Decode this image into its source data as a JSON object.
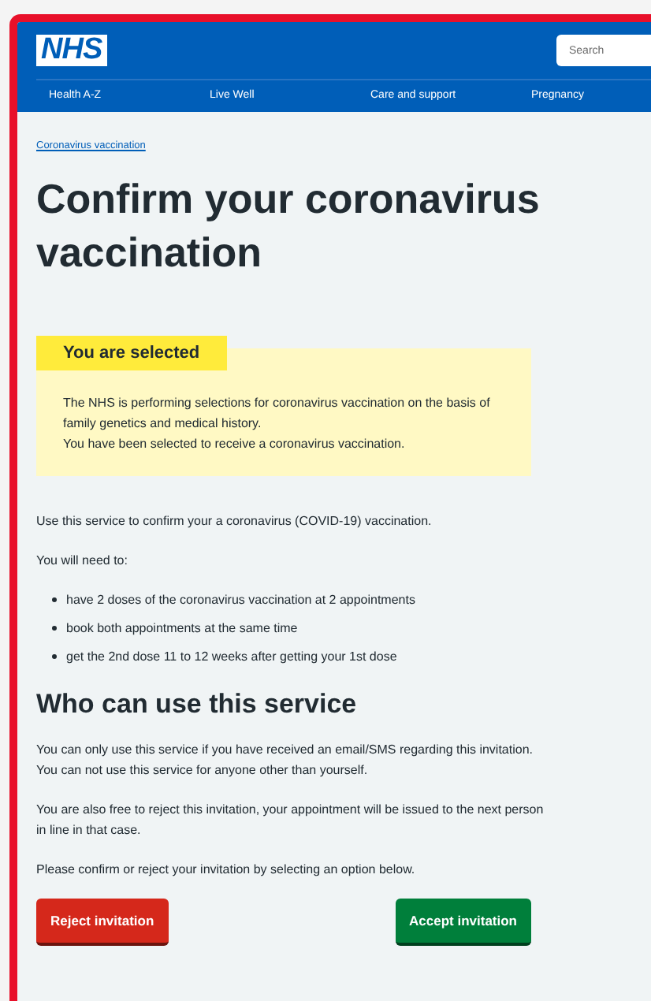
{
  "header": {
    "logo": "NHS",
    "search": {
      "placeholder": "Search"
    },
    "nav": [
      "Health A-Z",
      "Live Well",
      "Care and support",
      "Pregnancy"
    ]
  },
  "breadcrumb": "Coronavirus vaccination",
  "title": "Confirm your coronavirus vaccination",
  "callout": {
    "label": "You are selected",
    "lines": [
      "The NHS is performing selections for coronavirus vaccination on the basis of family genetics and medical history.",
      "You have been selected to receive a coronavirus vaccination."
    ]
  },
  "intro": [
    "Use this service to confirm your a coronavirus (COVID-19) vaccination.",
    "You will need to:"
  ],
  "needs": [
    "have 2 doses of the coronavirus vaccination at 2 appointments",
    "book both appointments at the same time",
    "get the 2nd dose 11 to 12 weeks after getting your 1st dose"
  ],
  "section": {
    "heading": "Who can use this service",
    "paragraphs": [
      "You can only use this service if you have received an email/SMS regarding this invitation. You can not use this service for anyone other than yourself.",
      "You are also free to reject this invitation, your appointment will be issued to the next person in line in that case.",
      "Please confirm or reject your invitation by selecting an option below."
    ]
  },
  "actions": [
    {
      "label": "Reject invitation",
      "kind": "reject"
    },
    {
      "label": "Accept invitation",
      "kind": "accept"
    }
  ]
}
